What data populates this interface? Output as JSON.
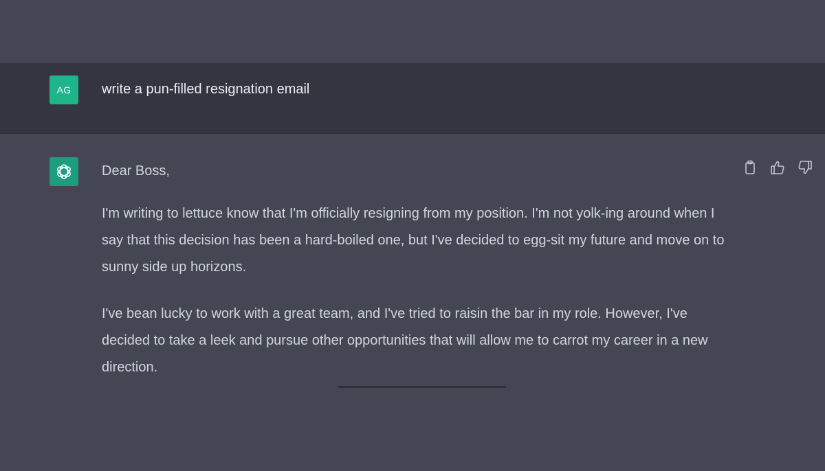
{
  "user_message": {
    "avatar_initials": "AG",
    "text": "write a pun-filled resignation email"
  },
  "assistant_message": {
    "avatar_icon": "openai-logo-icon",
    "greeting": "Dear Boss,",
    "paragraphs": [
      "I'm writing to lettuce know that I'm officially resigning from my position. I'm not yolk-ing around when I say that this decision has been a hard-boiled one, but I've decided to egg-sit my future and move on to sunny side up horizons.",
      "I've bean lucky to work with a great team, and I've tried to raisin the bar in my role. However, I've decided to take a leek and pursue other opportunities that will allow me to carrot my career in a new direction."
    ],
    "actions": [
      "copy-icon",
      "thumbs-up-icon",
      "thumbs-down-icon"
    ]
  },
  "colors": {
    "page_bg": "#444654",
    "user_row_bg": "#343541",
    "avatar_green": "#19c37d",
    "text_primary": "#ececf1",
    "text_secondary": "#d1d5db"
  }
}
